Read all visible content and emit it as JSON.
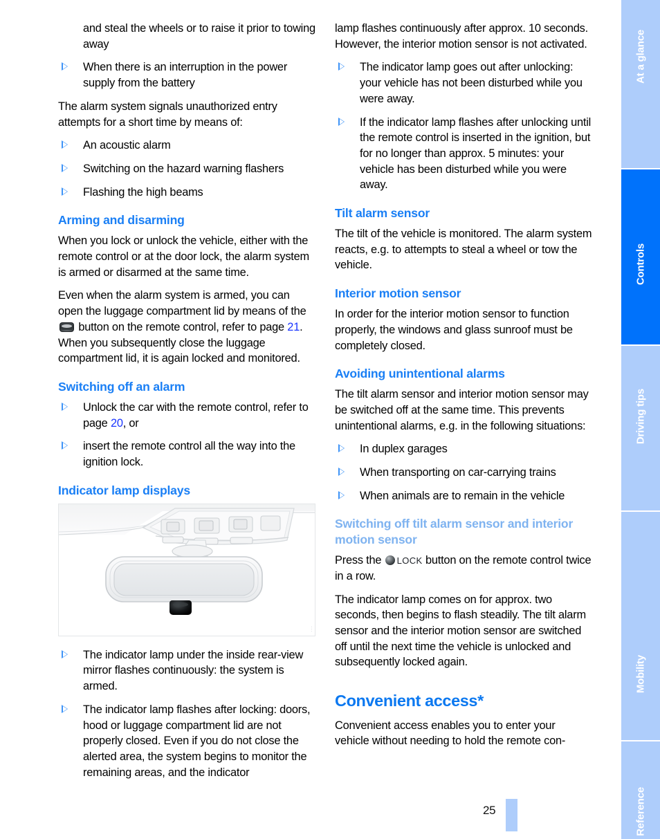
{
  "document": {
    "page_number": "25",
    "figure_id": "…"
  },
  "colors": {
    "heading_blue": "#1a7ff5",
    "heading_blue_light": "#7fb3f0",
    "chapter_blue": "#0b78f0",
    "link_blue": "#1a35ff",
    "tab_blue": "#aecdfb",
    "tab_active_blue": "#0072fb",
    "bullet_blue": "#3d93f7"
  },
  "left_column": {
    "continued_bullet": "and steal the wheels or to raise it prior to towing away",
    "bullet_power_supply": "When there is an interruption in the power supply from the battery",
    "paragraph_signals": "The alarm system signals unauthorized entry attempts for a short time by means of:",
    "bullet_acoustic": "An acoustic alarm",
    "bullet_hazard": "Switching on the hazard warning flashers",
    "bullet_high_beams": "Flashing the high beams",
    "heading_arming": "Arming and disarming",
    "paragraph_arming_1": "When you lock or unlock the vehicle, either with the remote control or at the door lock, the alarm system is armed or disarmed at the same time.",
    "paragraph_arming_2_part1": "Even when the alarm system is armed, you can open the luggage compartment lid by means of the",
    "paragraph_arming_2_part2": "button on the remote control, refer to page",
    "paragraph_arming_2_link": "21",
    "paragraph_arming_2_part3": ". When you subsequently close the luggage compartment lid, it is again locked and monitored.",
    "heading_switching_off": "Switching off an alarm",
    "bullet_unlock_part1": "Unlock the car with the remote control, refer to page",
    "bullet_unlock_link": "20",
    "bullet_unlock_part2": ", or",
    "bullet_insert": "insert the remote control all the way into the ignition lock.",
    "heading_indicator": "Indicator lamp displays",
    "bullet_indicator_1": "The indicator lamp under the inside rear-view mirror flashes continuously: the system is armed.",
    "bullet_indicator_2": "The indicator lamp flashes after locking: doors, hood or luggage compartment lid are not properly closed. Even if you do not close the alerted area, the system begins to monitor the remaining areas, and the indicator"
  },
  "right_column": {
    "continued_paragraph": "lamp flashes continuously after approx. 10 seconds. However, the interior motion sensor is not activated.",
    "bullet_goes_out": "The indicator lamp goes out after unlocking: your vehicle has not been disturbed while you were away.",
    "bullet_flashes": "If the indicator lamp flashes after unlocking until the remote control is inserted in the ignition, but for no longer than approx. 5 minutes: your vehicle has been disturbed while you were away.",
    "heading_tilt": "Tilt alarm sensor",
    "paragraph_tilt": "The tilt of the vehicle is monitored. The alarm system reacts, e.g. to attempts to steal a wheel or tow the vehicle.",
    "heading_interior_motion": "Interior motion sensor",
    "paragraph_interior_motion": "In order for the interior motion sensor to function properly, the windows and glass sunroof must be completely closed.",
    "heading_avoiding": "Avoiding unintentional alarms",
    "paragraph_avoiding": "The tilt alarm sensor and interior motion sensor may be switched off at the same time. This prevents unintentional alarms, e.g. in the following situations:",
    "bullet_duplex": "In duplex garages",
    "bullet_trains": "When transporting on car-carrying trains",
    "bullet_animals": "When animals are to remain in the vehicle",
    "heading_switching_off_sensors": "Switching off tilt alarm sensor and interior motion sensor",
    "paragraph_press_part1": "Press the",
    "paragraph_press_lock": "LOCK",
    "paragraph_press_part2": "button on the remote control twice in a row.",
    "paragraph_indicator_comes_on": "The indicator lamp comes on for approx. two seconds, then begins to flash steadily. The tilt alarm sensor and the interior motion sensor are switched off until the next time the vehicle is unlocked and subsequently locked again.",
    "heading_convenient_access": "Convenient access*",
    "paragraph_convenient_access": "Convenient access enables you to enter your vehicle without needing to hold the remote con-"
  },
  "sidebar": {
    "tabs": [
      {
        "label": "At a glance",
        "active": false
      },
      {
        "label": "Controls",
        "active": true
      },
      {
        "label": "Driving tips",
        "active": false
      },
      {
        "label": "Mobility",
        "active": false
      },
      {
        "label": "Reference",
        "active": false
      }
    ]
  }
}
